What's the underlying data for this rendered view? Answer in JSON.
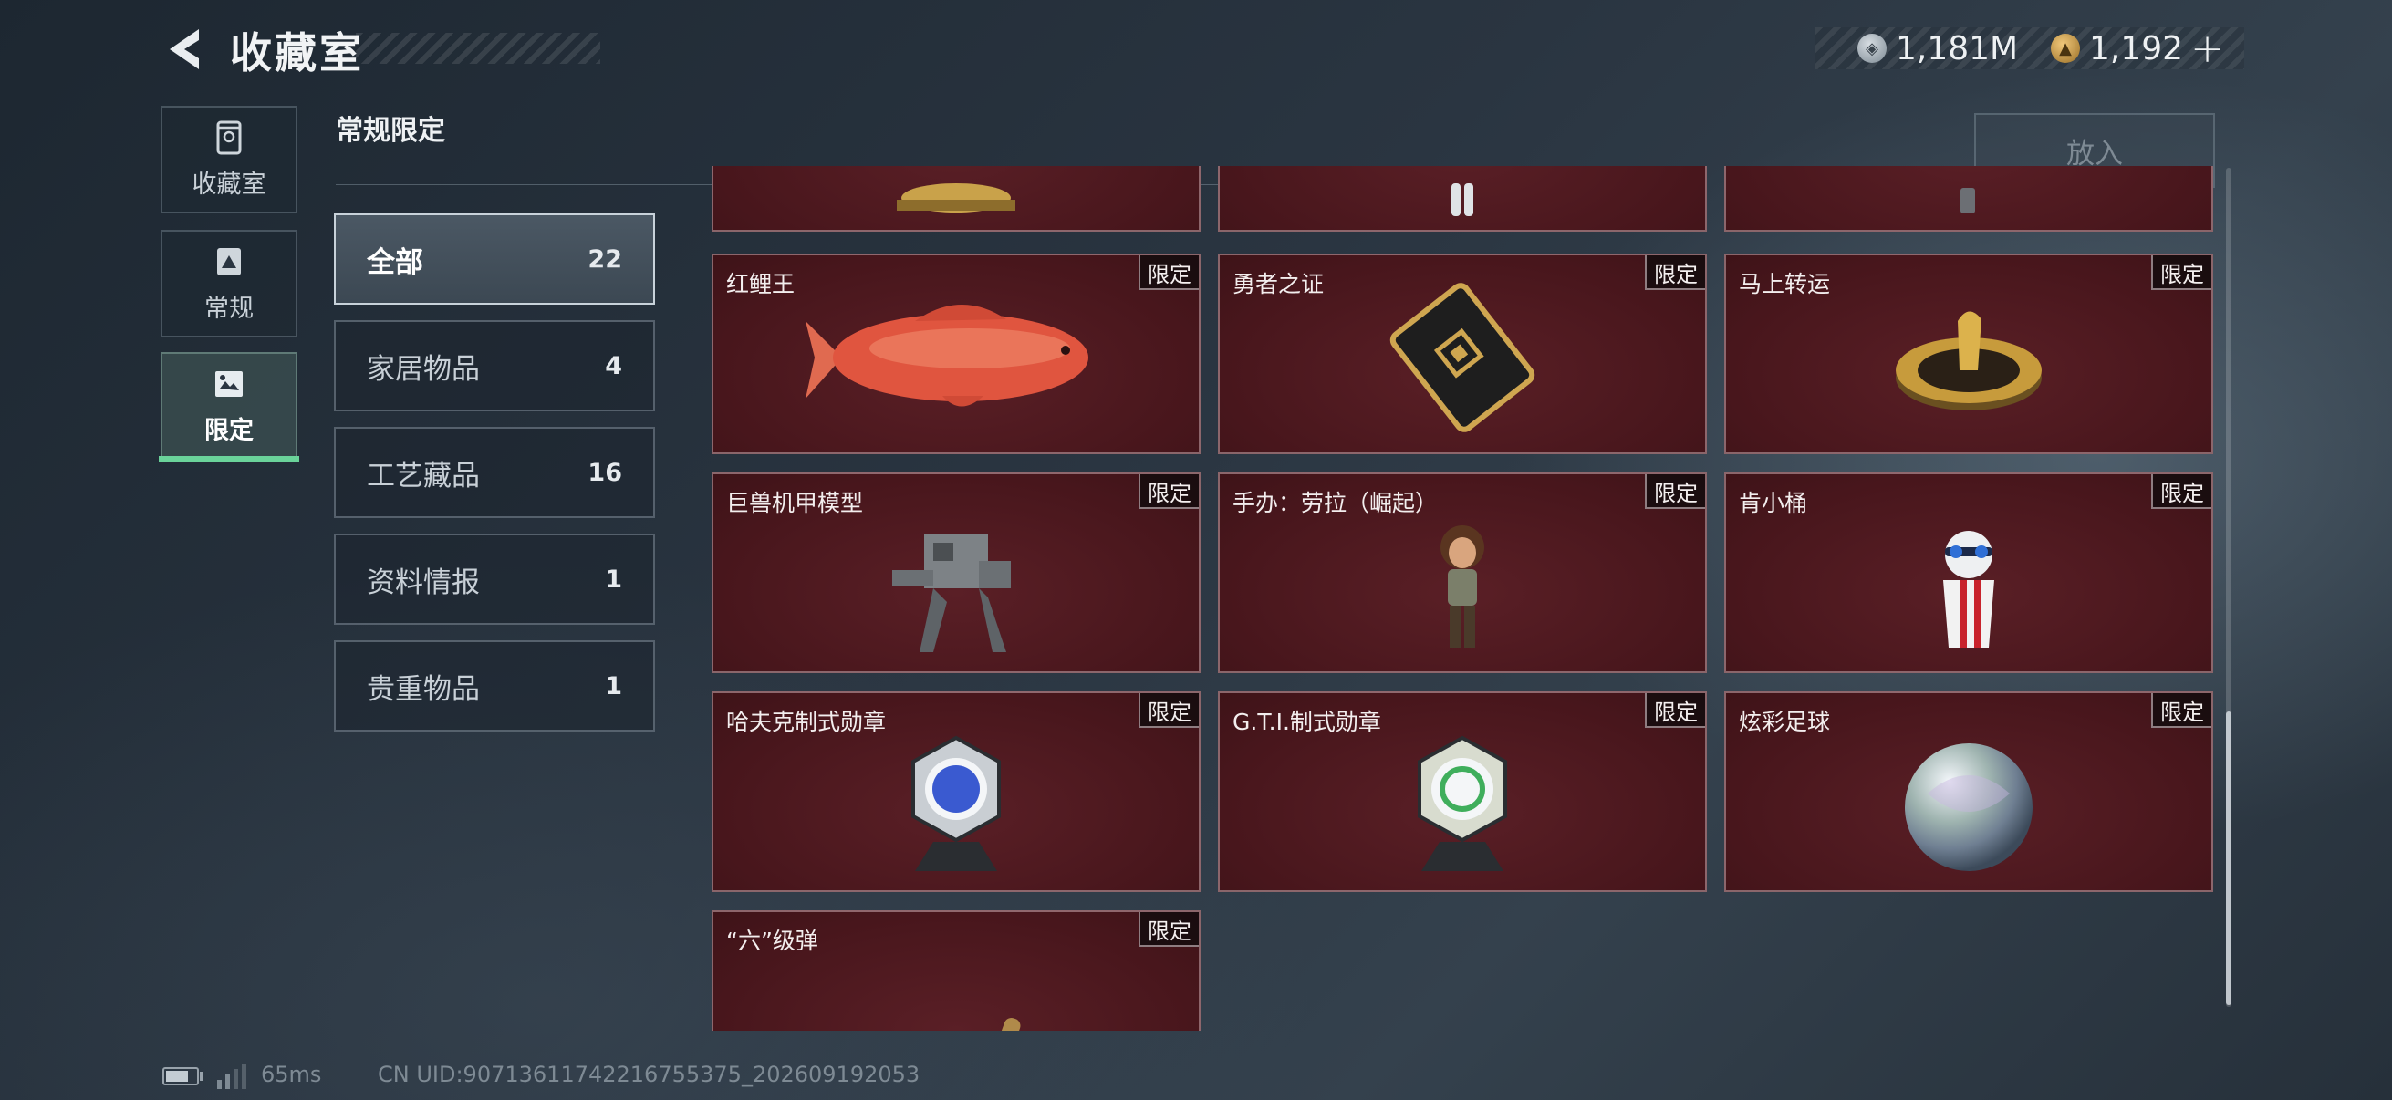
{
  "header": {
    "title": "收藏室",
    "currency": [
      {
        "icon": "silver-coin-icon",
        "value": "1,181M"
      },
      {
        "icon": "gold-coin-icon",
        "value": "1,192",
        "add": "+"
      }
    ]
  },
  "nav": [
    {
      "label": "收藏室",
      "icon": "display-cabinet-icon",
      "active": false
    },
    {
      "label": "常规",
      "icon": "card-triangle-icon",
      "active": false
    },
    {
      "label": "限定",
      "icon": "limited-frame-icon",
      "active": true
    }
  ],
  "section": {
    "title": "常规限定",
    "put_button": "放入"
  },
  "categories": [
    {
      "name": "全部",
      "count": "22",
      "active": true
    },
    {
      "name": "家居物品",
      "count": "4"
    },
    {
      "name": "工艺藏品",
      "count": "16"
    },
    {
      "name": "资料情报",
      "count": "1"
    },
    {
      "name": "贵重物品",
      "count": "1"
    }
  ],
  "items": [
    {
      "name": "",
      "badge": "",
      "art": "partial-gold"
    },
    {
      "name": "",
      "badge": "",
      "art": "partial-figure"
    },
    {
      "name": "",
      "badge": "",
      "art": "partial-small"
    },
    {
      "name": "红鲤王",
      "badge": "限定",
      "art": "carp"
    },
    {
      "name": "勇者之证",
      "badge": "限定",
      "art": "card"
    },
    {
      "name": "马上转运",
      "badge": "限定",
      "art": "wheel"
    },
    {
      "name": "巨兽机甲模型",
      "badge": "限定",
      "art": "mech"
    },
    {
      "name": "手办：劳拉（崛起）",
      "badge": "限定",
      "art": "lara"
    },
    {
      "name": "肯小桶",
      "badge": "限定",
      "art": "kfc"
    },
    {
      "name": "哈夫克制式勋章",
      "badge": "限定",
      "art": "medal-blue"
    },
    {
      "name": "G.T.I.制式勋章",
      "badge": "限定",
      "art": "medal-green"
    },
    {
      "name": "炫彩足球",
      "badge": "限定",
      "art": "ball"
    },
    {
      "name": "“六”级弹",
      "badge": "限定",
      "art": "hand"
    }
  ],
  "footer": {
    "ping": "65ms",
    "uid": "CN UID:9071361174221675537​5_202609192053"
  }
}
